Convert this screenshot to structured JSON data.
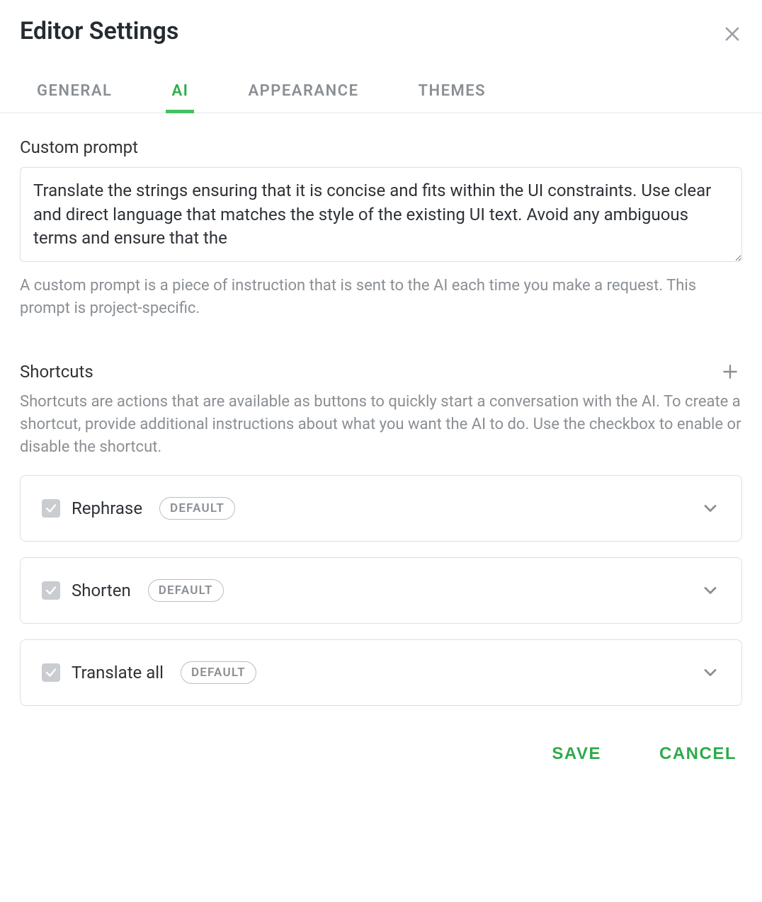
{
  "header": {
    "title": "Editor Settings"
  },
  "tabs": [
    {
      "label": "GENERAL",
      "active": false
    },
    {
      "label": "AI",
      "active": true
    },
    {
      "label": "APPEARANCE",
      "active": false
    },
    {
      "label": "THEMES",
      "active": false
    }
  ],
  "custom_prompt": {
    "label": "Custom prompt",
    "value": "Translate the strings ensuring that it is concise and fits within the UI constraints. Use clear and direct language that matches the style of the existing UI text. Avoid any ambiguous terms and ensure that the",
    "help": "A custom prompt is a piece of instruction that is sent to the AI each time you make a request. This prompt is project-specific."
  },
  "shortcuts": {
    "label": "Shortcuts",
    "help": "Shortcuts are actions that are available as buttons to quickly start a conversation with the AI. To create a shortcut, provide additional instructions about what you want the AI to do. Use the checkbox to enable or disable the shortcut.",
    "items": [
      {
        "name": "Rephrase",
        "badge": "DEFAULT",
        "checked": true
      },
      {
        "name": "Shorten",
        "badge": "DEFAULT",
        "checked": true
      },
      {
        "name": "Translate all",
        "badge": "DEFAULT",
        "checked": true
      }
    ]
  },
  "footer": {
    "save": "SAVE",
    "cancel": "CANCEL"
  }
}
